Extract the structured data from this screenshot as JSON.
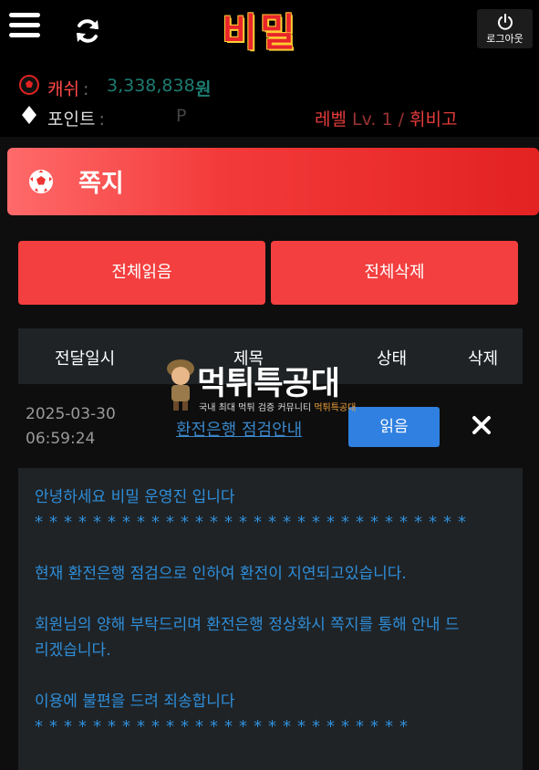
{
  "header": {
    "logo_text": "비밀",
    "logout_label": "로그아웃"
  },
  "account": {
    "cash_label": "캐쉬",
    "cash_colon": ":",
    "cash_value": "3,338,838",
    "cash_unit": "원",
    "point_label": "포인트",
    "point_colon": ":",
    "point_value": "P",
    "level_label": "레벨",
    "level_value": "Lv. 1",
    "level_sep": "/",
    "level_name": "휘비고"
  },
  "page": {
    "title": "쪽지",
    "read_all_label": "전체읽음",
    "delete_all_label": "전체삭제"
  },
  "table": {
    "columns": [
      "전달일시",
      "제목",
      "상태",
      "삭제"
    ],
    "rows": [
      {
        "date": "2025-03-30",
        "time": "06:59:24",
        "subject": "환전은행 점검안내",
        "status_button": "읽음"
      }
    ]
  },
  "message": {
    "greeting": "안녕하세요 비밀 운영진 입니다",
    "stars_1": "******************************",
    "line_1": "현재 환전은행 점검으로 인하여 환전이 지연되고있습니다.",
    "line_2a": "회원님의 양해 부탁드리며 환전은행 정상화시 쪽지를 통해 안내 드",
    "line_2b": "리겠습니다.",
    "line_3": "이용에 불편을 드려 죄송합니다",
    "stars_2": "**************************"
  },
  "watermark": {
    "title": "먹튀특공대",
    "subtitle_a": "국내 최대 먹튀 검증 커뮤니티",
    "subtitle_b": "먹튀특공대"
  },
  "colors": {
    "accent_red": "#f33f3f",
    "cash_teal": "#1c7d72",
    "link_blue": "#3a86c8",
    "read_button_blue": "#2f80e0"
  }
}
